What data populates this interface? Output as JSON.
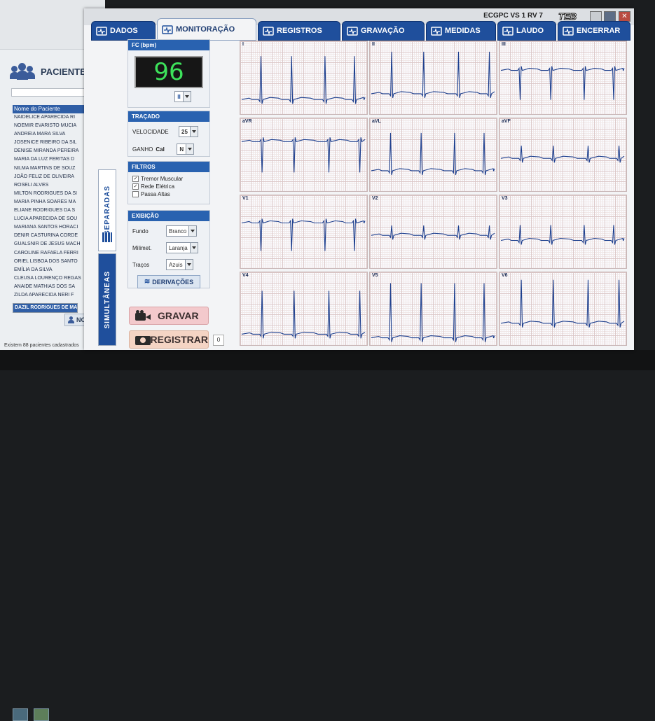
{
  "patients": {
    "title": "PACIENTES",
    "column_header": "Nome do Paciente",
    "rows": [
      "NAIDELICE APARECIDA RI",
      "NOEMIR EVARISTO MUCIA",
      "ANDREIA MARA SILVA",
      "JOSENICE RIBEIRO DA SIL",
      "DENISE MIRANDA PEREIRA",
      "MARIA DA LUZ FERITAS D",
      "NILMA MARTINS DE SOUZ",
      "JOÃO FELIZ DE OLIVEIRA",
      "ROSELI ALVES",
      "MILTON RODRIGUES DA SI",
      "MARIA PINHA SOARES MA",
      "ELIANE RODRIGUES DA S",
      "LUCIA APARECIDA DE SOU",
      "MARIANA SANTOS HORACI",
      "DENIR CASTURINA CORDE",
      "GUALSNIR DE JESUS MACH",
      "CAROLINE RAFAELA FERRI",
      "ORIEL LISBOA DOS SANTO",
      "EMÍLIA DA SILVA",
      "CLEUSA LOURENÇO REGAS",
      "ANAIDE MATHIAS DOS SA",
      "ZILDA APARECIDA NERI F",
      "DAZIL RODRIGUES DE MA"
    ],
    "selected_index": 22,
    "new_button": "NOVO",
    "count_text": "Existem 88 pacientes cadastrados"
  },
  "titlebar": {
    "title": "ECGPC VS 1 RV 7",
    "logo": "TEB"
  },
  "tabs": [
    {
      "label": "DADOS",
      "icon": "document-icon"
    },
    {
      "label": "MONITORAÇÃO",
      "icon": "monitor-icon"
    },
    {
      "label": "REGISTROS",
      "icon": "camera-icon"
    },
    {
      "label": "GRAVAÇÃO",
      "icon": "video-camera-icon"
    },
    {
      "label": "MEDIDAS",
      "icon": "ruler-icon"
    },
    {
      "label": "LAUDO",
      "icon": "edit-icon"
    },
    {
      "label": "ENCERRAR",
      "icon": "ecg-wave-icon"
    }
  ],
  "active_tab": 1,
  "side_tabs": {
    "separadas": "SEPARADAS",
    "simultaneas": "SIMULTÂNEAS"
  },
  "fc": {
    "header": "FC (bpm)",
    "value": "96",
    "lead": "II"
  },
  "tracado": {
    "header": "TRAÇADO",
    "velocidade_label": "VELOCIDADE",
    "velocidade_value": "25",
    "ganho_label": "GANHO",
    "ganho_sub": "Cal",
    "ganho_value": "N"
  },
  "filtros": {
    "header": "FILTROS",
    "items": [
      {
        "label": "Tremor Muscular",
        "checked": true
      },
      {
        "label": "Rede Elétrica",
        "checked": true
      },
      {
        "label": "Passa Altas",
        "checked": false
      }
    ]
  },
  "exibicao": {
    "header": "EXIBIÇÃO",
    "fundo_label": "Fundo",
    "fundo_value": "Branco",
    "milimet_label": "Milimet.",
    "milimet_value": "Laranja",
    "tracos_label": "Traços",
    "tracos_value": "Azuis",
    "derivacoes_button": "DERIVAÇÕES"
  },
  "actions": {
    "gravar": "GRAVAR",
    "registrar": "REGISTRAR",
    "registrar_count": "0"
  },
  "colors": {
    "tab_blue": "#1f4f9c",
    "panel_header": "#2962b0",
    "ecg_trace": "#1d3f8e",
    "digital_green": "#3de25b"
  },
  "leads": [
    "I",
    "II",
    "III",
    "aVR",
    "aVL",
    "aVF",
    "V1",
    "V2",
    "V3",
    "V4",
    "V5",
    "V6"
  ]
}
